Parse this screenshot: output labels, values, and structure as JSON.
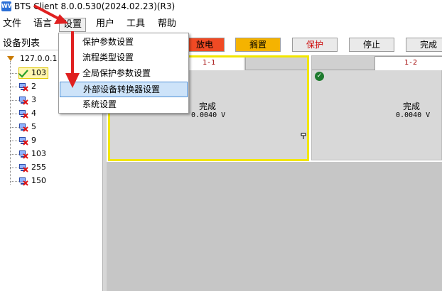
{
  "app": {
    "title": "BTS Client 8.0.0.530(2024.02.23)(R3)",
    "icon_name": "bts-app-icon",
    "icon_text": "WW"
  },
  "menubar": {
    "items": [
      "文件",
      "语言",
      "设置",
      "用户",
      "工具",
      "帮助"
    ],
    "open_menu": "设置"
  },
  "settings_menu": {
    "items": [
      "保护参数设置",
      "流程类型设置",
      "全局保护参数设置",
      "外部设备转换器设置",
      "系统设置"
    ],
    "highlighted_index": 3
  },
  "left_pane": {
    "header": "设备列表",
    "root_label": "127.0.0.1",
    "devices": [
      {
        "label": "103",
        "status": "ok",
        "selected": true
      },
      {
        "label": "2",
        "status": "disconnected"
      },
      {
        "label": "3",
        "status": "disconnected"
      },
      {
        "label": "4",
        "status": "disconnected"
      },
      {
        "label": "5",
        "status": "disconnected"
      },
      {
        "label": "9",
        "status": "disconnected"
      },
      {
        "label": "103",
        "status": "disconnected"
      },
      {
        "label": "255",
        "status": "disconnected"
      },
      {
        "label": "150",
        "status": "disconnected"
      }
    ]
  },
  "toolbar": {
    "buttons": [
      {
        "label": "放电",
        "color": "#f04a24",
        "text_color": "#000000"
      },
      {
        "label": "搁置",
        "color": "#f5b300",
        "text_color": "#000000"
      },
      {
        "label": "保护",
        "color": "#eaeaea",
        "text_color": "#cc0000"
      },
      {
        "label": "停止",
        "color": "#eaeaea",
        "text_color": "#000000"
      },
      {
        "label": "完成",
        "color": "#eaeaea",
        "text_color": "#000000"
      }
    ]
  },
  "channels": [
    {
      "id": "1-1",
      "status": "完成",
      "voltage": "0.0040 V",
      "selected": true
    },
    {
      "id": "1-2",
      "status": "完成",
      "voltage": "0.0040 V",
      "selected": false
    }
  ],
  "colors": {
    "selection_border": "#f2e600",
    "annotation_arrow": "#e02020",
    "highlight": "#cde3f9"
  }
}
